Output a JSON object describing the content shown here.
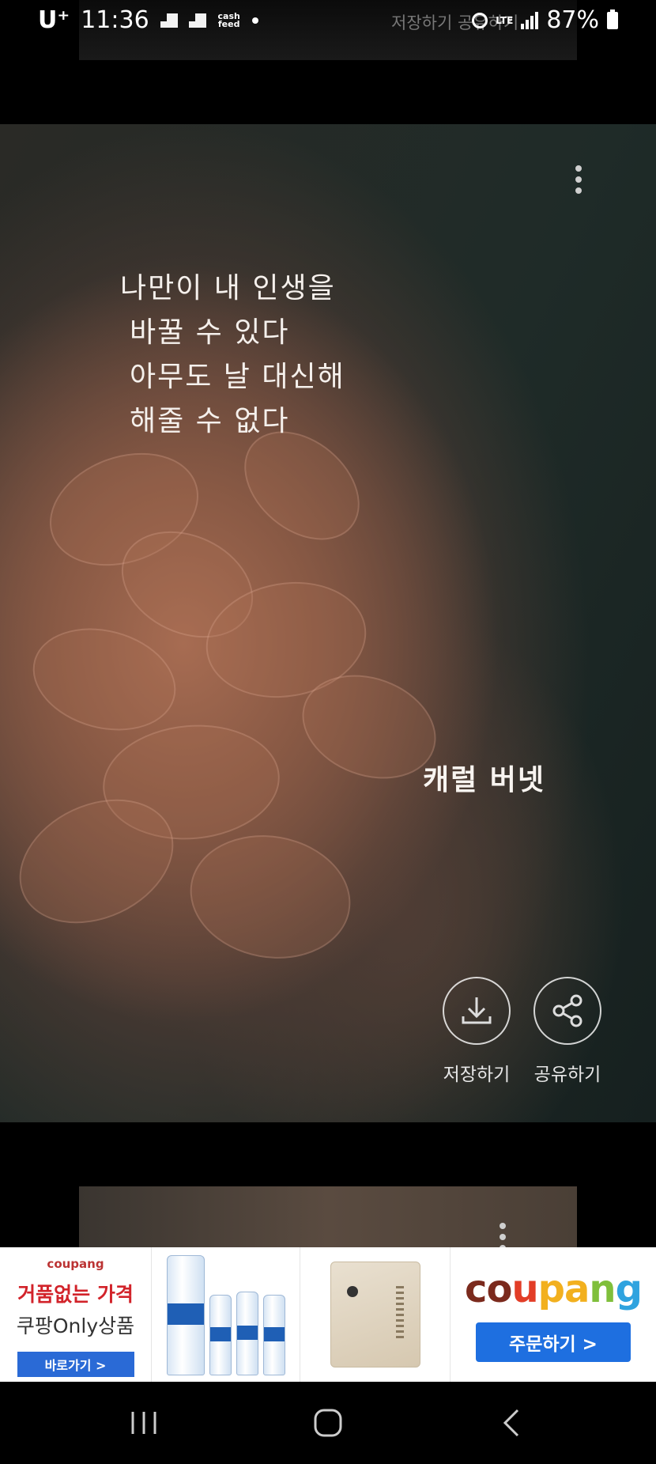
{
  "status_bar": {
    "carrier": "U⁺",
    "time": "11:36",
    "cash_label": "cash feed",
    "ghost_text": "저장하기   공유하기",
    "network": "LTE",
    "battery": "87%"
  },
  "quote_card": {
    "lines": [
      "나만이 내 인생을",
      "바꿀 수 있다",
      "아무도 날 대신해",
      "해줄 수 없다"
    ],
    "author": "캐럴 버넷",
    "actions": {
      "save_label": "저장하기",
      "share_label": "공유하기"
    }
  },
  "ad_banner": {
    "promo_logo": "coupang",
    "promo_line1": "거품없는 가격",
    "promo_line2": "쿠팡Only상품",
    "promo_button": "바로가기 >",
    "brand": "coupang",
    "order_button": "주문하기 >"
  },
  "colors": {
    "ad_button_blue": "#1e6fe0",
    "coupang_red": "#d2232a"
  }
}
